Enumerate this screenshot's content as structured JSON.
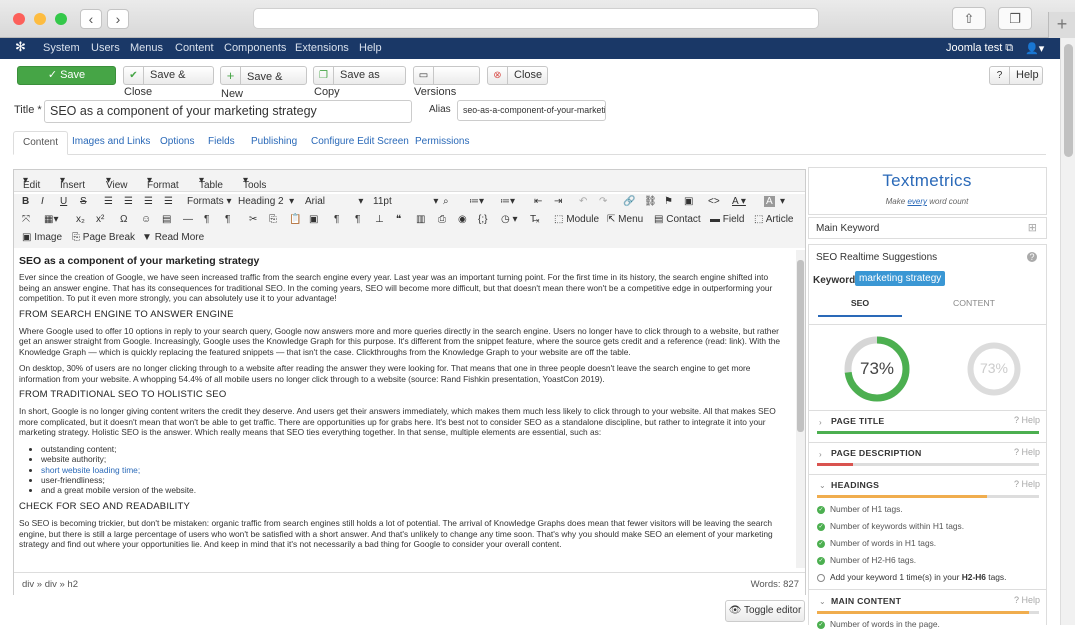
{
  "browser": {
    "add_tab": "+"
  },
  "navbar": {
    "menu": [
      "System",
      "Users",
      "Menus",
      "Content",
      "Components",
      "Extensions",
      "Help"
    ],
    "site_name": "Joomla test"
  },
  "toolbar": {
    "save": "Save",
    "save_close": "Save & Close",
    "save_new": "Save & New",
    "save_copy": "Save as Copy",
    "versions": "Versions",
    "close": "Close",
    "help": "Help"
  },
  "form": {
    "title_label": "Title *",
    "title_value": "SEO as a component of your marketing strategy",
    "alias_label": "Alias",
    "alias_value": "seo-as-a-component-of-your-marketi"
  },
  "tabs": [
    "Content",
    "Images and Links",
    "Options",
    "Fields",
    "Publishing",
    "Configure Edit Screen",
    "Permissions"
  ],
  "editor": {
    "menus": [
      "Edit",
      "Insert",
      "View",
      "Format",
      "Table",
      "Tools"
    ],
    "formats_label": "Formats",
    "block_label": "Heading 2",
    "font_label": "Arial",
    "size_label": "11pt",
    "buttons": {
      "module": "Module",
      "menu": "Menu",
      "contact": "Contact",
      "field": "Field",
      "article": "Article",
      "image": "Image",
      "page_break": "Page Break",
      "read_more": "Read More"
    },
    "path": "div » div » h2",
    "words": "Words: 827",
    "toggle": "Toggle editor",
    "content": {
      "h1": "SEO as a component of your marketing strategy",
      "p1": "Ever since the creation of Google, we have seen increased traffic from the search engine every year. Last year was an important turning point. For the first time in its history, the search engine shifted into being an answer engine. That has its consequences for traditional SEO. In the coming years, SEO will become more difficult, but that doesn't mean there won't be a competitive edge in outperforming your competition. To put it even more strongly, you can absolutely use it to your advantage!",
      "h2a": "FROM SEARCH ENGINE TO ANSWER ENGINE",
      "p2": "Where Google used to offer 10 options in reply to your search query, Google now answers more and more queries directly in the search engine. Users no longer have to click through to a website, but rather get an answer straight from Google. Increasingly, Google uses the Knowledge Graph for this purpose. It's different from the snippet feature, where the source gets credit and a reference (read: link). With the Knowledge Graph — which is quickly replacing the featured snippets — that isn't the case. Clickthroughs from the Knowledge Graph to your website are off the table.",
      "p3": "On desktop, 30% of users are no longer clicking through to a website after reading the answer they were looking for. That means that one in three people doesn't leave the search engine to get more information from your website. A whopping 54.4% of all mobile users no longer click through to a website (source: Rand Fishkin presentation, YoastCon 2019).",
      "h2b": "FROM TRADITIONAL SEO TO HOLISTIC SEO",
      "p4": "In short, Google is no longer giving content writers the credit they deserve. And users get their answers immediately, which makes them much less likely to click through to your website. All that makes SEO more complicated, but it doesn't mean that won't be able to get traffic. There are opportunities up for grabs here. It's best not to consider SEO as a standalone discipline, but rather to integrate it into your marketing strategy. Holistic SEO is the answer. Which really means that SEO ties everything together. In that sense, multiple elements are essential, such as:",
      "list": [
        "outstanding content;",
        "website authority;",
        "short website loading time;",
        "user-friendliness;",
        "and a great mobile version of the website."
      ],
      "h2c": "CHECK FOR SEO AND READABILITY",
      "p5": "So SEO is becoming trickier, but don't be mistaken: organic traffic from search engines still holds a lot of potential. The arrival of Knowledge Graphs does mean that fewer visitors will be leaving the search engine, but there is still a large percentage of users who won't be satisfied with a short answer. And that's unlikely to change any time soon. That's why you should make SEO an element of your marketing strategy and find out where your opportunities lie. And keep in mind that it's not necessarily a bad thing for Google to consider your overall content."
    }
  },
  "textmetrics": {
    "logo": "Textmetrics",
    "tag_pre": "Make ",
    "tag_em": "every",
    "tag_post": " word count",
    "main_keyword": "Main Keyword",
    "suggestions": "SEO Realtime Suggestions",
    "keyword_label": "Keyword:",
    "keyword": "marketing strategy",
    "tab_seo": "SEO",
    "tab_content": "CONTENT",
    "seo_score": "73%",
    "content_score": "73%",
    "seo_fraction": 0.73,
    "help": "Help",
    "sections": {
      "page_title": "PAGE TITLE",
      "page_description": "PAGE DESCRIPTION",
      "headings": "HEADINGS",
      "main_content": "MAIN CONTENT"
    },
    "headings_checks": [
      "Number of H1 tags.",
      "Number of keywords within H1 tags.",
      "Number of words in H1 tags.",
      "Number of H2-H6 tags."
    ],
    "headings_todo": "Add your keyword 1 time(s) in your ",
    "headings_todo_b": "H2-H6",
    "headings_todo_end": " tags.",
    "main_check": "Number of words in the page."
  },
  "colors": {
    "navbar": "#1a3867",
    "save": "#46a546",
    "accent": "#2a69b8",
    "good": "#4caf50",
    "bad": "#d9534f",
    "warn": "#f0ad4e"
  }
}
